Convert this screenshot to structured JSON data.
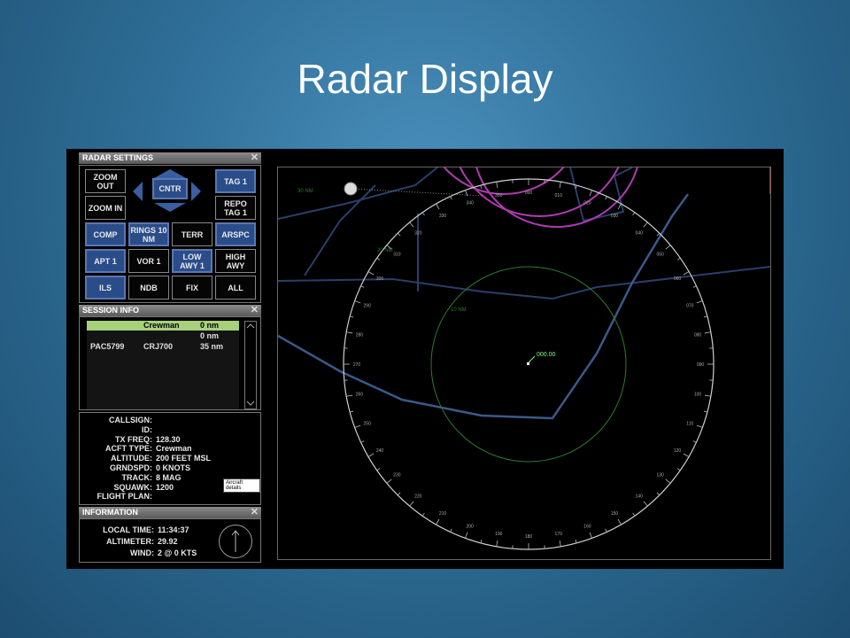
{
  "slide_title": "Radar Display",
  "radar_settings": {
    "title": "RADAR SETTINGS",
    "close": "✕",
    "buttons": {
      "zoom_out": "ZOOM OUT",
      "zoom_in": "ZOOM IN",
      "cntr": "CNTR",
      "tag1": "TAG 1",
      "repo_tag1": "REPO TAG 1",
      "comp": "COMP",
      "rings": "RINGS 10 NM",
      "terr": "TERR",
      "arspc": "ARSPC",
      "apt1": "APT 1",
      "vor1": "VOR 1",
      "low_awy": "LOW AWY 1",
      "high_awy": "HIGH AWY",
      "ils": "ILS",
      "ndb": "NDB",
      "fix": "FIX",
      "all": "ALL"
    }
  },
  "session_info": {
    "title": "SESSION INFO",
    "close": "✕",
    "rows": [
      {
        "callsign": "",
        "type": "Crewman",
        "dist": "0 nm",
        "highlight": true
      },
      {
        "callsign": "",
        "type": "",
        "dist": "0 nm",
        "highlight": false
      },
      {
        "callsign": "PAC5799",
        "type": "CRJ700",
        "dist": "35 nm",
        "highlight": false
      }
    ]
  },
  "aircraft_details": {
    "labels": [
      "CALLSIGN:",
      "ID:",
      "TX FREQ:",
      "ACFT TYPE:",
      "ALTITUDE:",
      "GRNDSPD:",
      "TRACK:",
      "SQUAWK:",
      "FLIGHT PLAN:"
    ],
    "values": [
      "",
      "",
      "128.30",
      "Crewman",
      "200 FEET MSL",
      "0 KNOTS",
      "8 MAG",
      "1200",
      ""
    ],
    "tooltip": "Aircraft details"
  },
  "information": {
    "title": "INFORMATION",
    "close": "✕",
    "local_time_label": "LOCAL TIME:",
    "local_time": "11:34:37",
    "altimeter_label": "ALTIMETER:",
    "altimeter": "29.92",
    "wind_label": "WIND:",
    "wind": "2 @ 0 KTS"
  },
  "radar": {
    "aircraft_tag": "000.00",
    "inner_ring_label": "10 NM",
    "range_label_top": "30 NM",
    "range_label_mid": "20 NM",
    "bearing_labels": [
      "000",
      "010",
      "020",
      "030",
      "040",
      "050",
      "060",
      "070",
      "080",
      "090",
      "100",
      "110",
      "120",
      "130",
      "140",
      "150",
      "160",
      "170",
      "180",
      "190",
      "200",
      "210",
      "220",
      "230",
      "240",
      "250",
      "260",
      "270",
      "280",
      "290",
      "300",
      "310",
      "320",
      "330",
      "340",
      "350"
    ],
    "colors": {
      "ring": "#cfcfcf",
      "inner_ring": "#2f7a2f",
      "airspace": "#b03ab0",
      "airway": "#2a3f6a",
      "terrain_line": "#3a5a8a"
    }
  }
}
